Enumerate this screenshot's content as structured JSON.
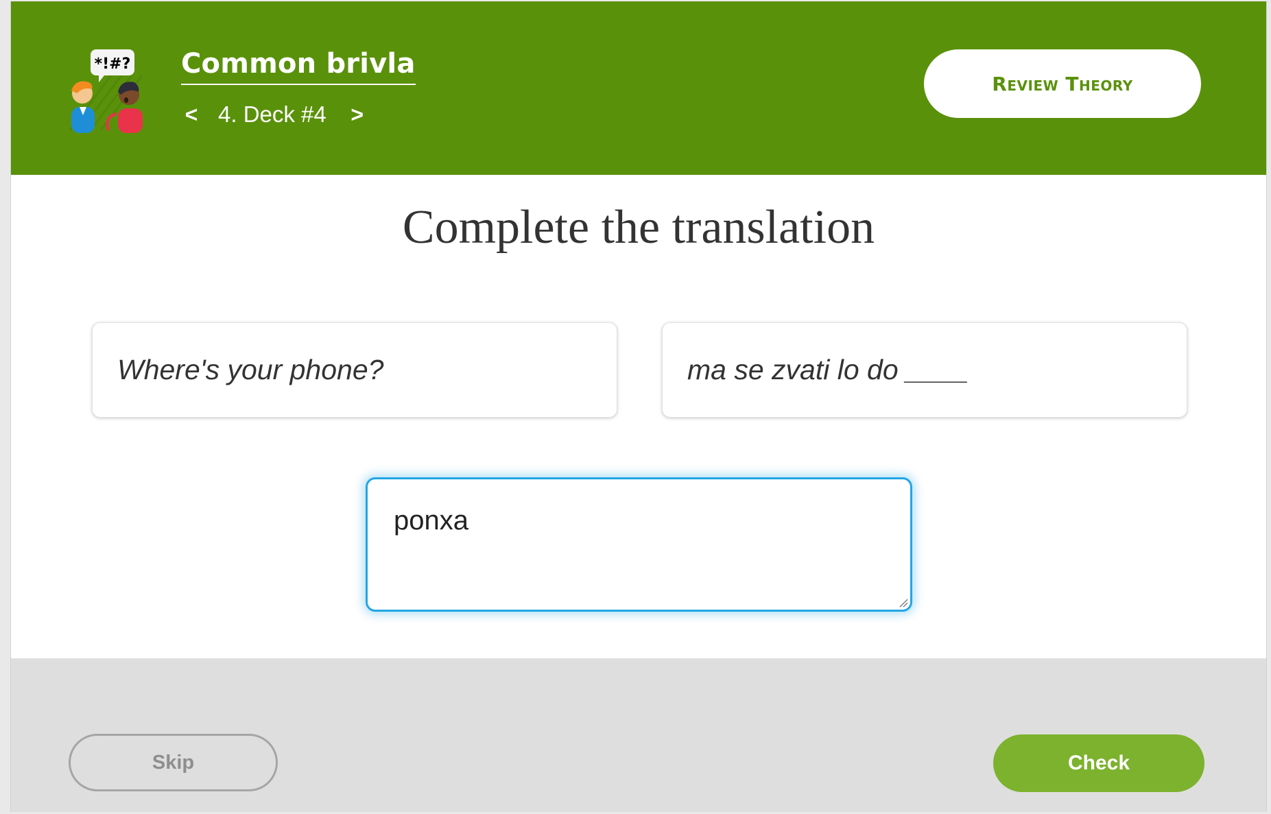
{
  "header": {
    "course_title": "Common brivla",
    "prev_arrow": "<",
    "deck_label": "4. Deck #4",
    "next_arrow": ">",
    "review_button": "Review Theory",
    "logo_speech_text": "*!#?"
  },
  "exercise": {
    "title": "Complete the translation",
    "source_sentence": "Where's your phone?",
    "target_sentence": "ma se zvati lo do ____",
    "answer_value": "ponxa"
  },
  "footer": {
    "skip_label": "Skip",
    "check_label": "Check"
  },
  "colors": {
    "header_bg": "#5a910b",
    "check_button": "#7cb22e",
    "input_focus": "#22a6e6",
    "footer_bg": "#dedede"
  }
}
